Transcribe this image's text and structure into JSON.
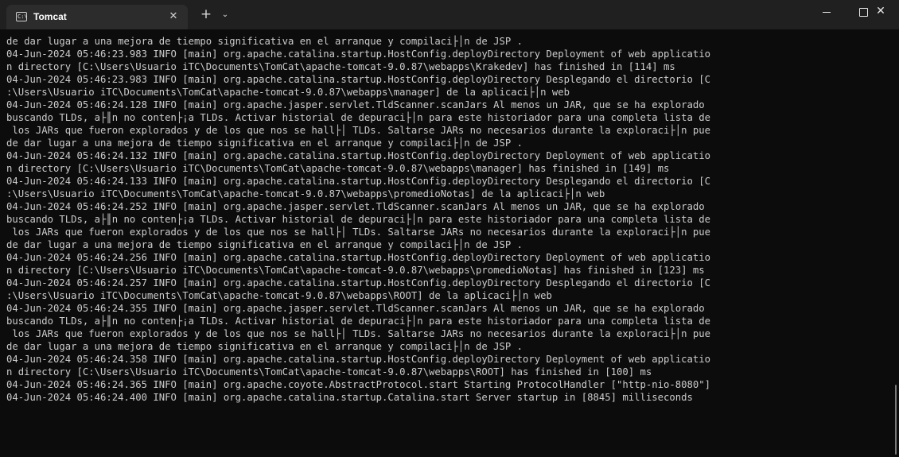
{
  "window": {
    "tab_title": "Tomcat",
    "tab_icon": "terminal-icon",
    "tab_icon_glyph": "C:\\",
    "close_tab_glyph": "✕",
    "new_tab_glyph": "+",
    "dropdown_glyph": "⌄",
    "close_window_glyph": "✕"
  },
  "console": {
    "lines": [
      "de dar lugar a una mejora de tiempo significativa en el arranque y compilaci├│n de JSP .",
      "04-Jun-2024 05:46:23.983 INFO [main] org.apache.catalina.startup.HostConfig.deployDirectory Deployment of web applicatio",
      "n directory [C:\\Users\\Usuario iTC\\Documents\\TomCat\\apache-tomcat-9.0.87\\webapps\\Krakedev] has finished in [114] ms",
      "04-Jun-2024 05:46:23.983 INFO [main] org.apache.catalina.startup.HostConfig.deployDirectory Desplegando el directorio [C",
      ":\\Users\\Usuario iTC\\Documents\\TomCat\\apache-tomcat-9.0.87\\webapps\\manager] de la aplicaci├│n web",
      "04-Jun-2024 05:46:24.128 INFO [main] org.apache.jasper.servlet.TldScanner.scanJars Al menos un JAR, que se ha explorado",
      "buscando TLDs, a├║n no conten├¡a TLDs. Activar historial de depuraci├│n para este historiador para una completa lista de",
      " los JARs que fueron explorados y de los que nos se hall├│ TLDs. Saltarse JARs no necesarios durante la exploraci├│n pue",
      "de dar lugar a una mejora de tiempo significativa en el arranque y compilaci├│n de JSP .",
      "04-Jun-2024 05:46:24.132 INFO [main] org.apache.catalina.startup.HostConfig.deployDirectory Deployment of web applicatio",
      "n directory [C:\\Users\\Usuario iTC\\Documents\\TomCat\\apache-tomcat-9.0.87\\webapps\\manager] has finished in [149] ms",
      "04-Jun-2024 05:46:24.133 INFO [main] org.apache.catalina.startup.HostConfig.deployDirectory Desplegando el directorio [C",
      ":\\Users\\Usuario iTC\\Documents\\TomCat\\apache-tomcat-9.0.87\\webapps\\promedioNotas] de la aplicaci├│n web",
      "04-Jun-2024 05:46:24.252 INFO [main] org.apache.jasper.servlet.TldScanner.scanJars Al menos un JAR, que se ha explorado",
      "buscando TLDs, a├║n no conten├¡a TLDs. Activar historial de depuraci├│n para este historiador para una completa lista de",
      " los JARs que fueron explorados y de los que nos se hall├│ TLDs. Saltarse JARs no necesarios durante la exploraci├│n pue",
      "de dar lugar a una mejora de tiempo significativa en el arranque y compilaci├│n de JSP .",
      "04-Jun-2024 05:46:24.256 INFO [main] org.apache.catalina.startup.HostConfig.deployDirectory Deployment of web applicatio",
      "n directory [C:\\Users\\Usuario iTC\\Documents\\TomCat\\apache-tomcat-9.0.87\\webapps\\promedioNotas] has finished in [123] ms",
      "04-Jun-2024 05:46:24.257 INFO [main] org.apache.catalina.startup.HostConfig.deployDirectory Desplegando el directorio [C",
      ":\\Users\\Usuario iTC\\Documents\\TomCat\\apache-tomcat-9.0.87\\webapps\\ROOT] de la aplicaci├│n web",
      "04-Jun-2024 05:46:24.355 INFO [main] org.apache.jasper.servlet.TldScanner.scanJars Al menos un JAR, que se ha explorado",
      "buscando TLDs, a├║n no conten├¡a TLDs. Activar historial de depuraci├│n para este historiador para una completa lista de",
      " los JARs que fueron explorados y de los que nos se hall├│ TLDs. Saltarse JARs no necesarios durante la exploraci├│n pue",
      "de dar lugar a una mejora de tiempo significativa en el arranque y compilaci├│n de JSP .",
      "04-Jun-2024 05:46:24.358 INFO [main] org.apache.catalina.startup.HostConfig.deployDirectory Deployment of web applicatio",
      "n directory [C:\\Users\\Usuario iTC\\Documents\\TomCat\\apache-tomcat-9.0.87\\webapps\\ROOT] has finished in [100] ms",
      "04-Jun-2024 05:46:24.365 INFO [main] org.apache.coyote.AbstractProtocol.start Starting ProtocolHandler [\"http-nio-8080\"]",
      "04-Jun-2024 05:46:24.400 INFO [main] org.apache.catalina.startup.Catalina.start Server startup in [8845] milliseconds"
    ]
  },
  "colors": {
    "background": "#0c0c0c",
    "titlebar": "#202020",
    "tab": "#2c2c2c",
    "text": "#cccccc"
  }
}
